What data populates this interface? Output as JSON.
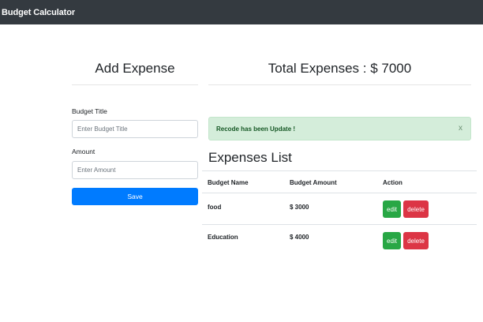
{
  "navbar": {
    "brand": "Budget Calculator"
  },
  "form": {
    "heading": "Add Expense",
    "title_label": "Budget Title",
    "title_placeholder": "Enter Budget Title",
    "amount_label": "Amount",
    "amount_placeholder": "Enter Amount",
    "save_label": "Save"
  },
  "summary": {
    "total_label": "Total Expenses : $ 7000"
  },
  "alert": {
    "message": "Recode has been Update !",
    "close": "x"
  },
  "expenses": {
    "title": "Expenses List",
    "columns": [
      "Budget Name",
      "Budget Amount",
      "Action"
    ],
    "rows": [
      {
        "name": "food",
        "amount": "$ 3000"
      },
      {
        "name": "Education",
        "amount": "$ 4000"
      }
    ],
    "edit_label": "edit",
    "delete_label": "delete"
  },
  "colors": {
    "navbar": "#343a40",
    "primary": "#007bff",
    "success": "#28a745",
    "danger": "#dc3545",
    "alert_bg": "#d4edda",
    "alert_text": "#155724"
  }
}
